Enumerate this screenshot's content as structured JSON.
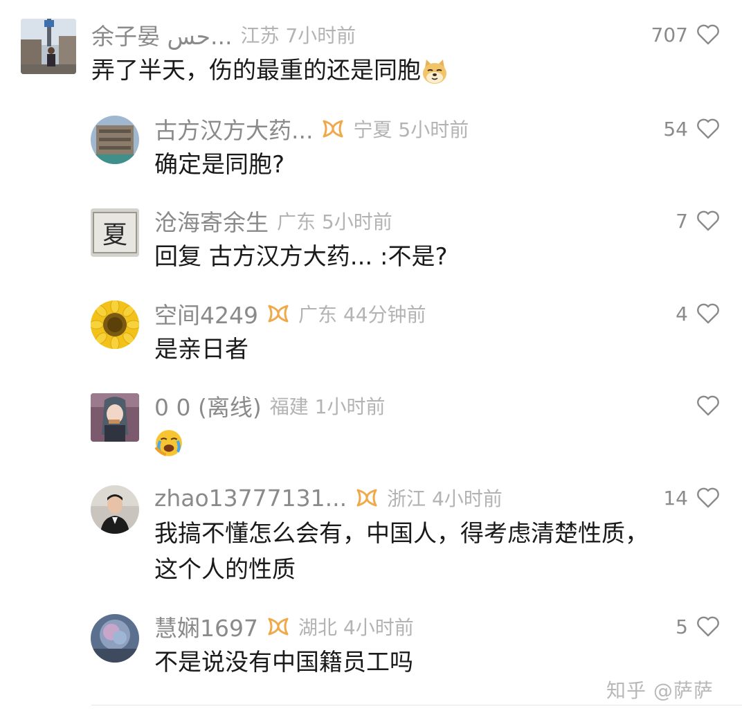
{
  "comments": [
    {
      "name": "余子晏 حس...",
      "location_time": "江苏 7小时前",
      "likes": "707",
      "text": "弄了半天，伤的最重的还是同胞",
      "emoji_icon": "doge-emoji",
      "has_badge": false
    },
    {
      "name": "古方汉方大药...",
      "location_time": "宁夏 5小时前",
      "likes": "54",
      "text": "确定是同胞?",
      "has_badge": true
    },
    {
      "name": "沧海寄余生",
      "location_time": "广东 5小时前",
      "likes": "7",
      "text": "回复 古方汉方大药... :不是?",
      "has_badge": false
    },
    {
      "name": "空间4249",
      "location_time": "广东 44分钟前",
      "likes": "4",
      "text": "是亲日者",
      "has_badge": true
    },
    {
      "name": "0 0 (离线)",
      "location_time": "福建 1小时前",
      "likes": "",
      "text": "",
      "emoji_icon": "crying-emoji",
      "has_badge": false
    },
    {
      "name": "zhao13777131...",
      "location_time": "浙江 4小时前",
      "likes": "14",
      "text_line1": "我搞不懂怎么会有，中国人，得考虑清楚性质，",
      "text_line2": "这个人的性质",
      "has_badge": true
    },
    {
      "name": "慧娴1697",
      "location_time": "湖北 4小时前",
      "likes": "5",
      "text": "不是说没有中国籍员工吗",
      "has_badge": true
    }
  ],
  "watermark": "知乎 @萨萨",
  "colors": {
    "name": "#8a8a8a",
    "location": "#b3b3b3",
    "text": "#1a1a1a",
    "badge": "#f0a94a"
  }
}
